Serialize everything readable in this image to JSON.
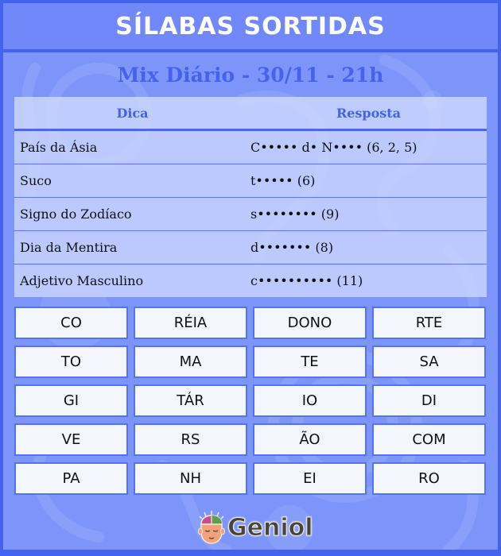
{
  "header": {
    "title": "SÍLABAS SORTIDAS"
  },
  "subtitle": "Mix Diário - 30/11 - 21h",
  "table": {
    "columns": [
      "Dica",
      "Resposta"
    ],
    "rows": [
      {
        "clue": "País da Ásia",
        "answer": "C••••• d• N•••• (6, 2, 5)"
      },
      {
        "clue": "Suco",
        "answer": "t••••• (6)"
      },
      {
        "clue": "Signo do Zodíaco",
        "answer": "s•••••••• (9)"
      },
      {
        "clue": "Dia da Mentira",
        "answer": "d••••••• (8)"
      },
      {
        "clue": "Adjetivo Masculino",
        "answer": "c•••••••••• (11)"
      }
    ]
  },
  "syllables": [
    "CO",
    "RÉIA",
    "DONO",
    "RTE",
    "TO",
    "MA",
    "TE",
    "SA",
    "GI",
    "TÁR",
    "IO",
    "DI",
    "VE",
    "RS",
    "ÃO",
    "COM",
    "PA",
    "NH",
    "EI",
    "RO"
  ],
  "footer": {
    "logo_text": "Geniol",
    "logo_icon": "brain-head-icon"
  },
  "colors": {
    "frame": "#4463ec",
    "title_bar": "#7088f9",
    "panel": "#7d95fa",
    "accent_text": "#4463ec",
    "tile_bg": "#f4f6fe",
    "tile_border": "#5573ee"
  }
}
